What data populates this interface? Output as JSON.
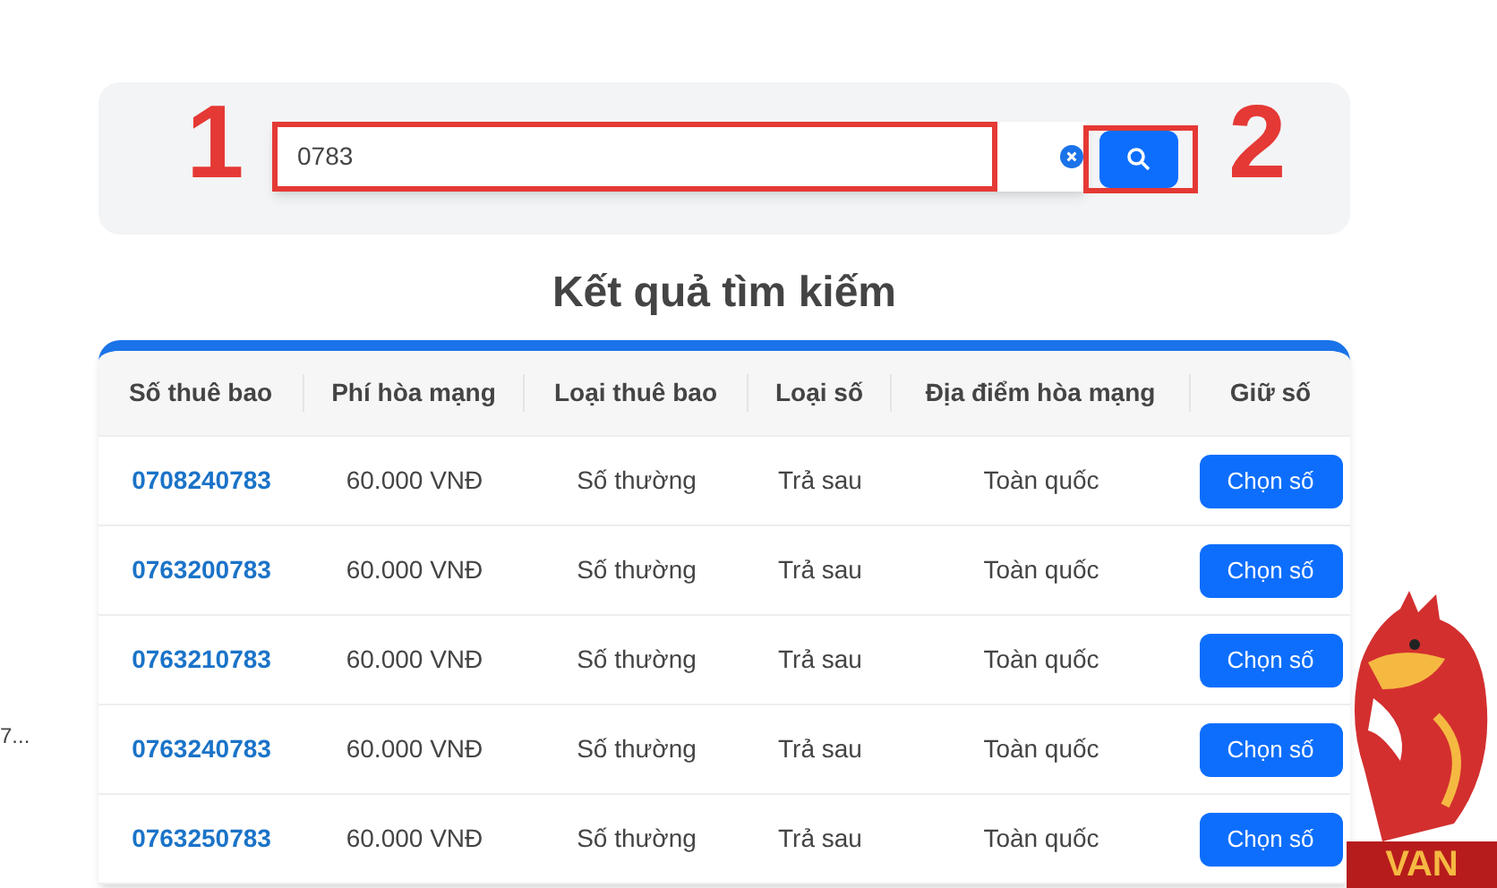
{
  "search": {
    "value": "0783",
    "annotations": [
      {
        "label": "1"
      },
      {
        "label": "2"
      }
    ]
  },
  "results_title": "Kết quả tìm kiếm",
  "table": {
    "columns": [
      "Số thuê bao",
      "Phí hòa mạng",
      "Loại thuê bao",
      "Loại số",
      "Địa điểm hòa mạng",
      "Giữ số"
    ],
    "rows": [
      {
        "number": "0708240783",
        "fee": "60.000 VNĐ",
        "subscription_type": "Số thường",
        "number_type": "Trả sau",
        "location": "Toàn quốc",
        "button": "Chọn số"
      },
      {
        "number": "0763200783",
        "fee": "60.000 VNĐ",
        "subscription_type": "Số thường",
        "number_type": "Trả sau",
        "location": "Toàn quốc",
        "button": "Chọn số"
      },
      {
        "number": "0763210783",
        "fee": "60.000 VNĐ",
        "subscription_type": "Số thường",
        "number_type": "Trả sau",
        "location": "Toàn quốc",
        "button": "Chọn số"
      },
      {
        "number": "0763240783",
        "fee": "60.000 VNĐ",
        "subscription_type": "Số thường",
        "number_type": "Trả sau",
        "location": "Toàn quốc",
        "button": "Chọn số"
      },
      {
        "number": "0763250783",
        "fee": "60.000 VNĐ",
        "subscription_type": "Số thường",
        "number_type": "Trả sau",
        "location": "Toàn quốc",
        "button": "Chọn số"
      }
    ]
  },
  "side_text": "7...",
  "mascot": {
    "label": "VAN"
  }
}
